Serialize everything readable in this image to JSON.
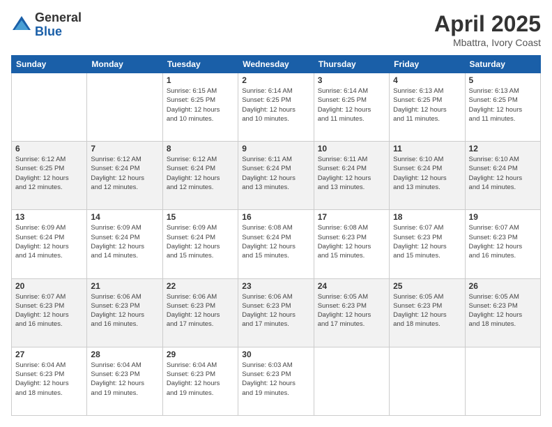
{
  "logo": {
    "general": "General",
    "blue": "Blue"
  },
  "title": "April 2025",
  "location": "Mbattra, Ivory Coast",
  "days_header": [
    "Sunday",
    "Monday",
    "Tuesday",
    "Wednesday",
    "Thursday",
    "Friday",
    "Saturday"
  ],
  "weeks": [
    [
      {
        "day": "",
        "info": ""
      },
      {
        "day": "",
        "info": ""
      },
      {
        "day": "1",
        "info": "Sunrise: 6:15 AM\nSunset: 6:25 PM\nDaylight: 12 hours\nand 10 minutes."
      },
      {
        "day": "2",
        "info": "Sunrise: 6:14 AM\nSunset: 6:25 PM\nDaylight: 12 hours\nand 10 minutes."
      },
      {
        "day": "3",
        "info": "Sunrise: 6:14 AM\nSunset: 6:25 PM\nDaylight: 12 hours\nand 11 minutes."
      },
      {
        "day": "4",
        "info": "Sunrise: 6:13 AM\nSunset: 6:25 PM\nDaylight: 12 hours\nand 11 minutes."
      },
      {
        "day": "5",
        "info": "Sunrise: 6:13 AM\nSunset: 6:25 PM\nDaylight: 12 hours\nand 11 minutes."
      }
    ],
    [
      {
        "day": "6",
        "info": "Sunrise: 6:12 AM\nSunset: 6:25 PM\nDaylight: 12 hours\nand 12 minutes."
      },
      {
        "day": "7",
        "info": "Sunrise: 6:12 AM\nSunset: 6:24 PM\nDaylight: 12 hours\nand 12 minutes."
      },
      {
        "day": "8",
        "info": "Sunrise: 6:12 AM\nSunset: 6:24 PM\nDaylight: 12 hours\nand 12 minutes."
      },
      {
        "day": "9",
        "info": "Sunrise: 6:11 AM\nSunset: 6:24 PM\nDaylight: 12 hours\nand 13 minutes."
      },
      {
        "day": "10",
        "info": "Sunrise: 6:11 AM\nSunset: 6:24 PM\nDaylight: 12 hours\nand 13 minutes."
      },
      {
        "day": "11",
        "info": "Sunrise: 6:10 AM\nSunset: 6:24 PM\nDaylight: 12 hours\nand 13 minutes."
      },
      {
        "day": "12",
        "info": "Sunrise: 6:10 AM\nSunset: 6:24 PM\nDaylight: 12 hours\nand 14 minutes."
      }
    ],
    [
      {
        "day": "13",
        "info": "Sunrise: 6:09 AM\nSunset: 6:24 PM\nDaylight: 12 hours\nand 14 minutes."
      },
      {
        "day": "14",
        "info": "Sunrise: 6:09 AM\nSunset: 6:24 PM\nDaylight: 12 hours\nand 14 minutes."
      },
      {
        "day": "15",
        "info": "Sunrise: 6:09 AM\nSunset: 6:24 PM\nDaylight: 12 hours\nand 15 minutes."
      },
      {
        "day": "16",
        "info": "Sunrise: 6:08 AM\nSunset: 6:24 PM\nDaylight: 12 hours\nand 15 minutes."
      },
      {
        "day": "17",
        "info": "Sunrise: 6:08 AM\nSunset: 6:23 PM\nDaylight: 12 hours\nand 15 minutes."
      },
      {
        "day": "18",
        "info": "Sunrise: 6:07 AM\nSunset: 6:23 PM\nDaylight: 12 hours\nand 15 minutes."
      },
      {
        "day": "19",
        "info": "Sunrise: 6:07 AM\nSunset: 6:23 PM\nDaylight: 12 hours\nand 16 minutes."
      }
    ],
    [
      {
        "day": "20",
        "info": "Sunrise: 6:07 AM\nSunset: 6:23 PM\nDaylight: 12 hours\nand 16 minutes."
      },
      {
        "day": "21",
        "info": "Sunrise: 6:06 AM\nSunset: 6:23 PM\nDaylight: 12 hours\nand 16 minutes."
      },
      {
        "day": "22",
        "info": "Sunrise: 6:06 AM\nSunset: 6:23 PM\nDaylight: 12 hours\nand 17 minutes."
      },
      {
        "day": "23",
        "info": "Sunrise: 6:06 AM\nSunset: 6:23 PM\nDaylight: 12 hours\nand 17 minutes."
      },
      {
        "day": "24",
        "info": "Sunrise: 6:05 AM\nSunset: 6:23 PM\nDaylight: 12 hours\nand 17 minutes."
      },
      {
        "day": "25",
        "info": "Sunrise: 6:05 AM\nSunset: 6:23 PM\nDaylight: 12 hours\nand 18 minutes."
      },
      {
        "day": "26",
        "info": "Sunrise: 6:05 AM\nSunset: 6:23 PM\nDaylight: 12 hours\nand 18 minutes."
      }
    ],
    [
      {
        "day": "27",
        "info": "Sunrise: 6:04 AM\nSunset: 6:23 PM\nDaylight: 12 hours\nand 18 minutes."
      },
      {
        "day": "28",
        "info": "Sunrise: 6:04 AM\nSunset: 6:23 PM\nDaylight: 12 hours\nand 19 minutes."
      },
      {
        "day": "29",
        "info": "Sunrise: 6:04 AM\nSunset: 6:23 PM\nDaylight: 12 hours\nand 19 minutes."
      },
      {
        "day": "30",
        "info": "Sunrise: 6:03 AM\nSunset: 6:23 PM\nDaylight: 12 hours\nand 19 minutes."
      },
      {
        "day": "",
        "info": ""
      },
      {
        "day": "",
        "info": ""
      },
      {
        "day": "",
        "info": ""
      }
    ]
  ]
}
